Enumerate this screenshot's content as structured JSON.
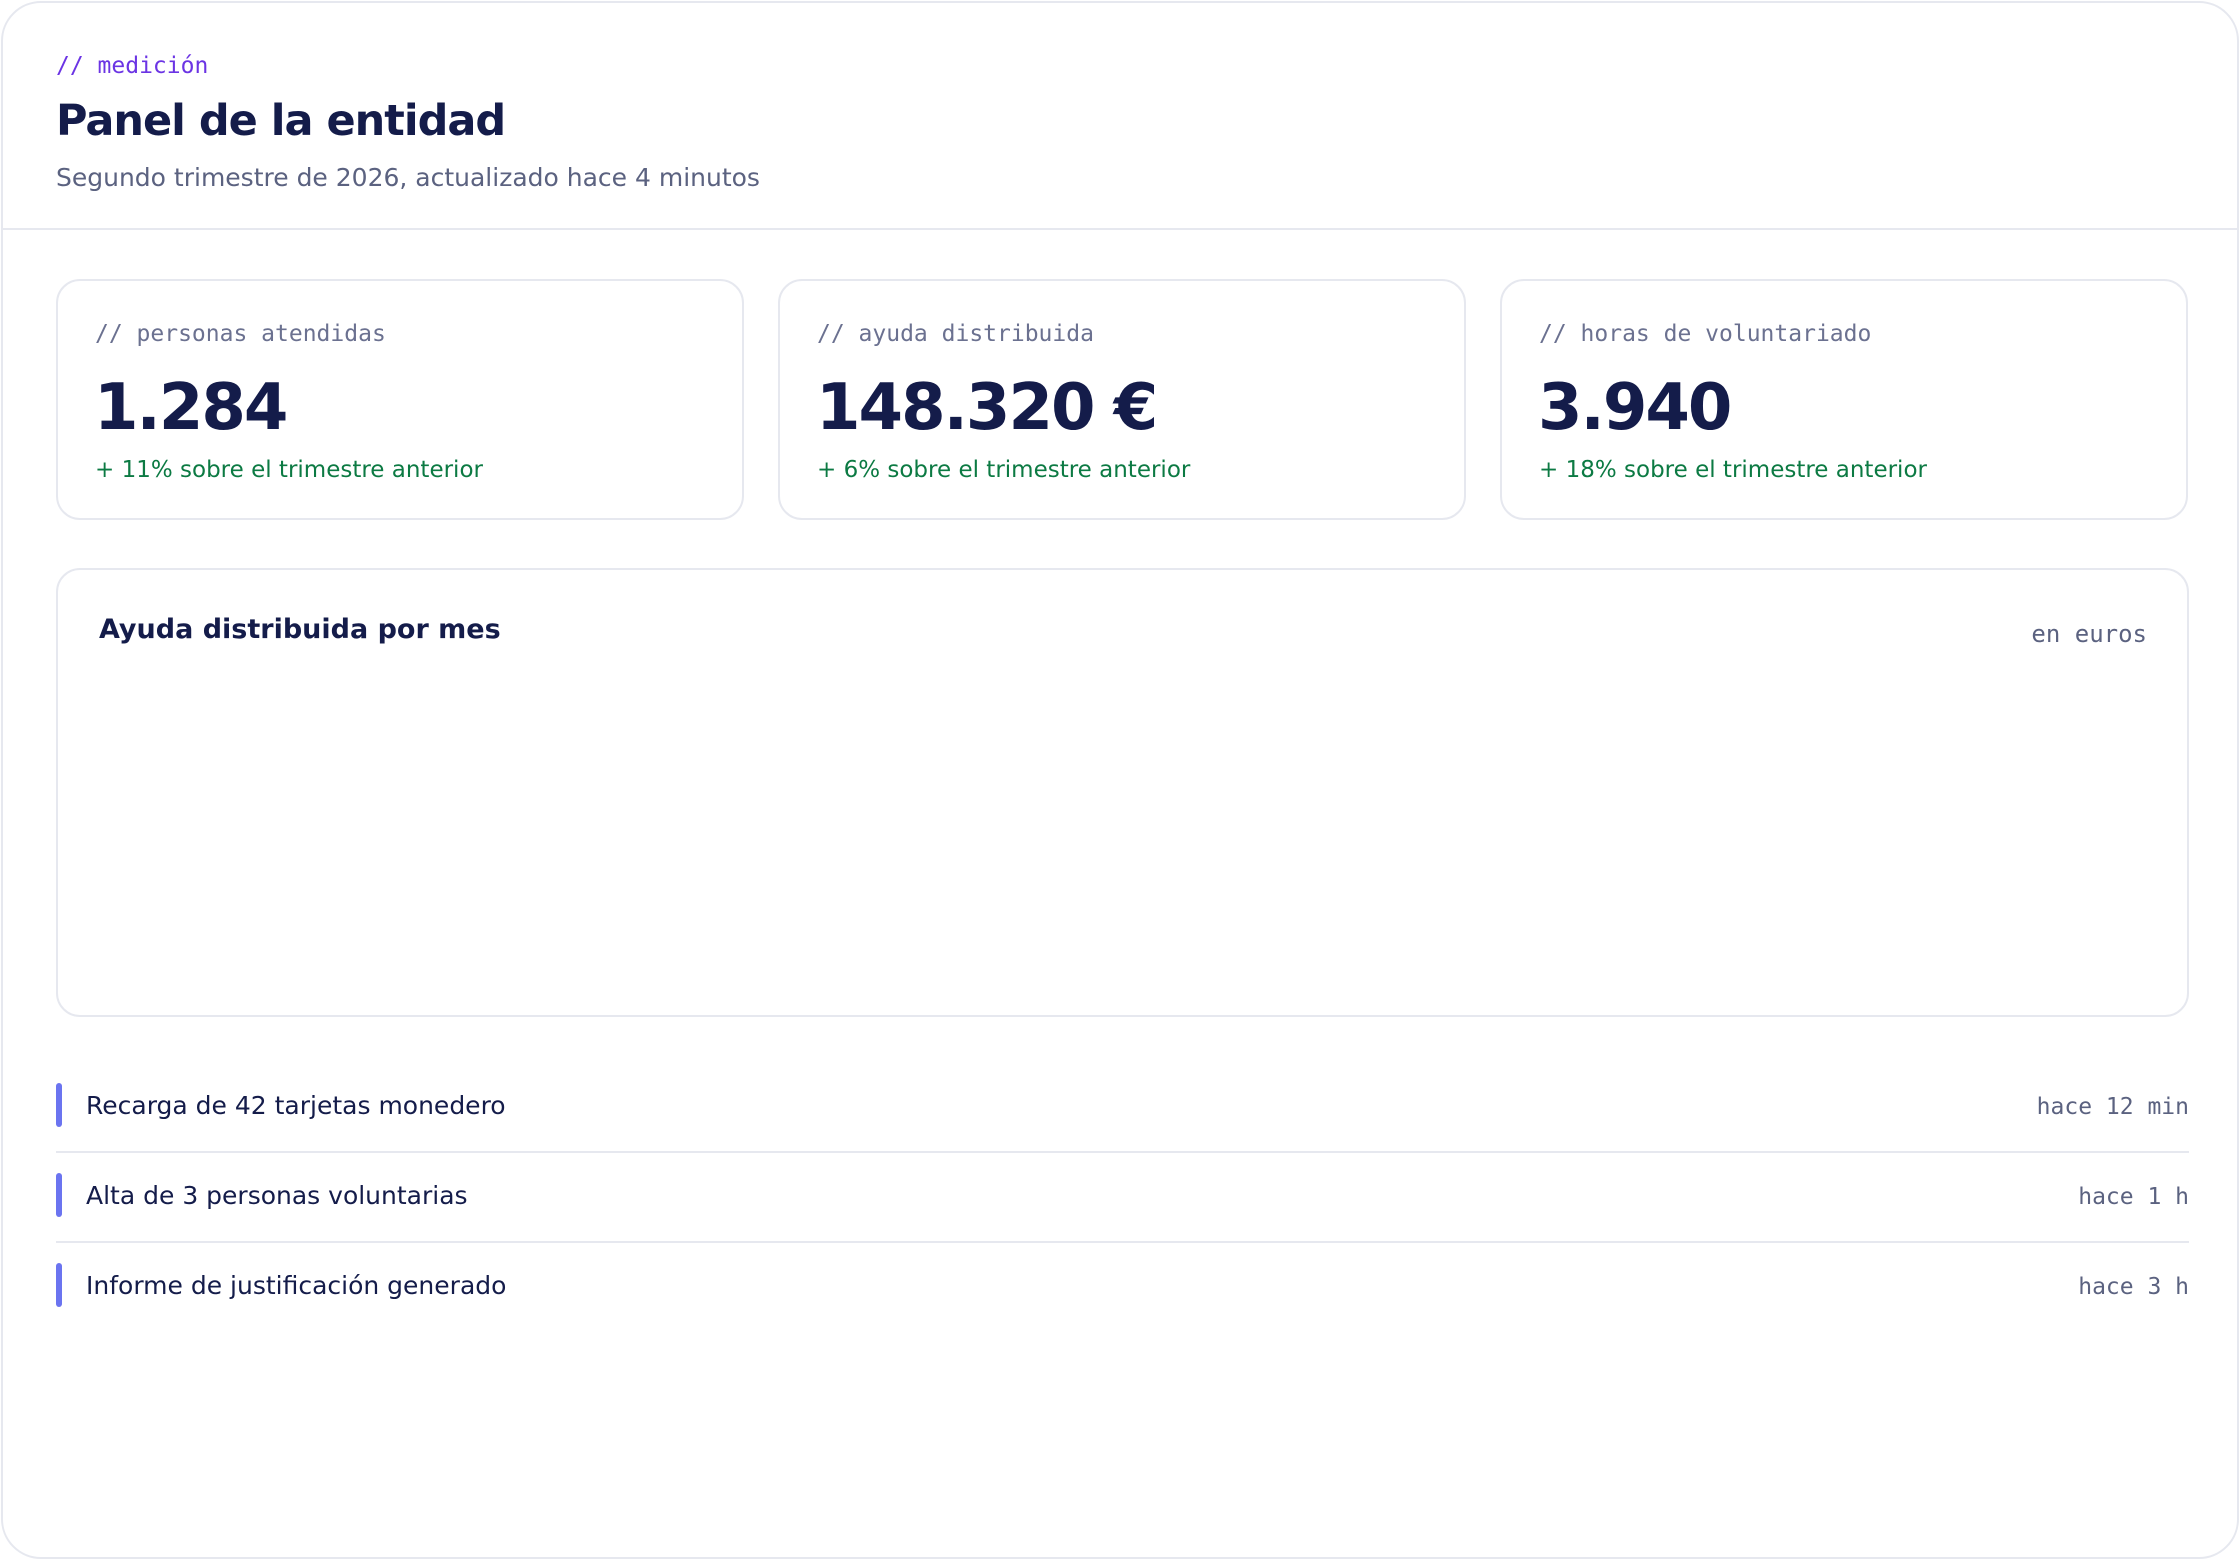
{
  "header": {
    "eyebrow": "// medición",
    "title": "Panel de la entidad",
    "subtitle": "Segundo trimestre de 2026, actualizado hace 4 minutos"
  },
  "stats": [
    {
      "label": "// personas atendidas",
      "value": "1.284",
      "delta": "+ 11% sobre el trimestre anterior"
    },
    {
      "label": "// ayuda distribuida",
      "value": "148.320 €",
      "delta": "+ 6% sobre el trimestre anterior"
    },
    {
      "label": "// horas de voluntariado",
      "value": "3.940",
      "delta": "+ 18% sobre el trimestre anterior"
    }
  ],
  "chart_panel": {
    "title": "Ayuda distribuida por mes",
    "unit": "en euros"
  },
  "activity": [
    {
      "text": "Recarga de 42 tarjetas monedero",
      "time": "hace 12 min"
    },
    {
      "text": "Alta de 3 personas voluntarias",
      "time": "hace 1 h"
    },
    {
      "text": "Informe de justificación generado",
      "time": "hace 3 h"
    }
  ],
  "colors": {
    "accent": "#6b34e4",
    "ink": "#141c4a",
    "muted": "#5b6280",
    "positive": "#0c7a43",
    "activity_marker": "#6b74f0",
    "border": "#e6e8ef"
  }
}
